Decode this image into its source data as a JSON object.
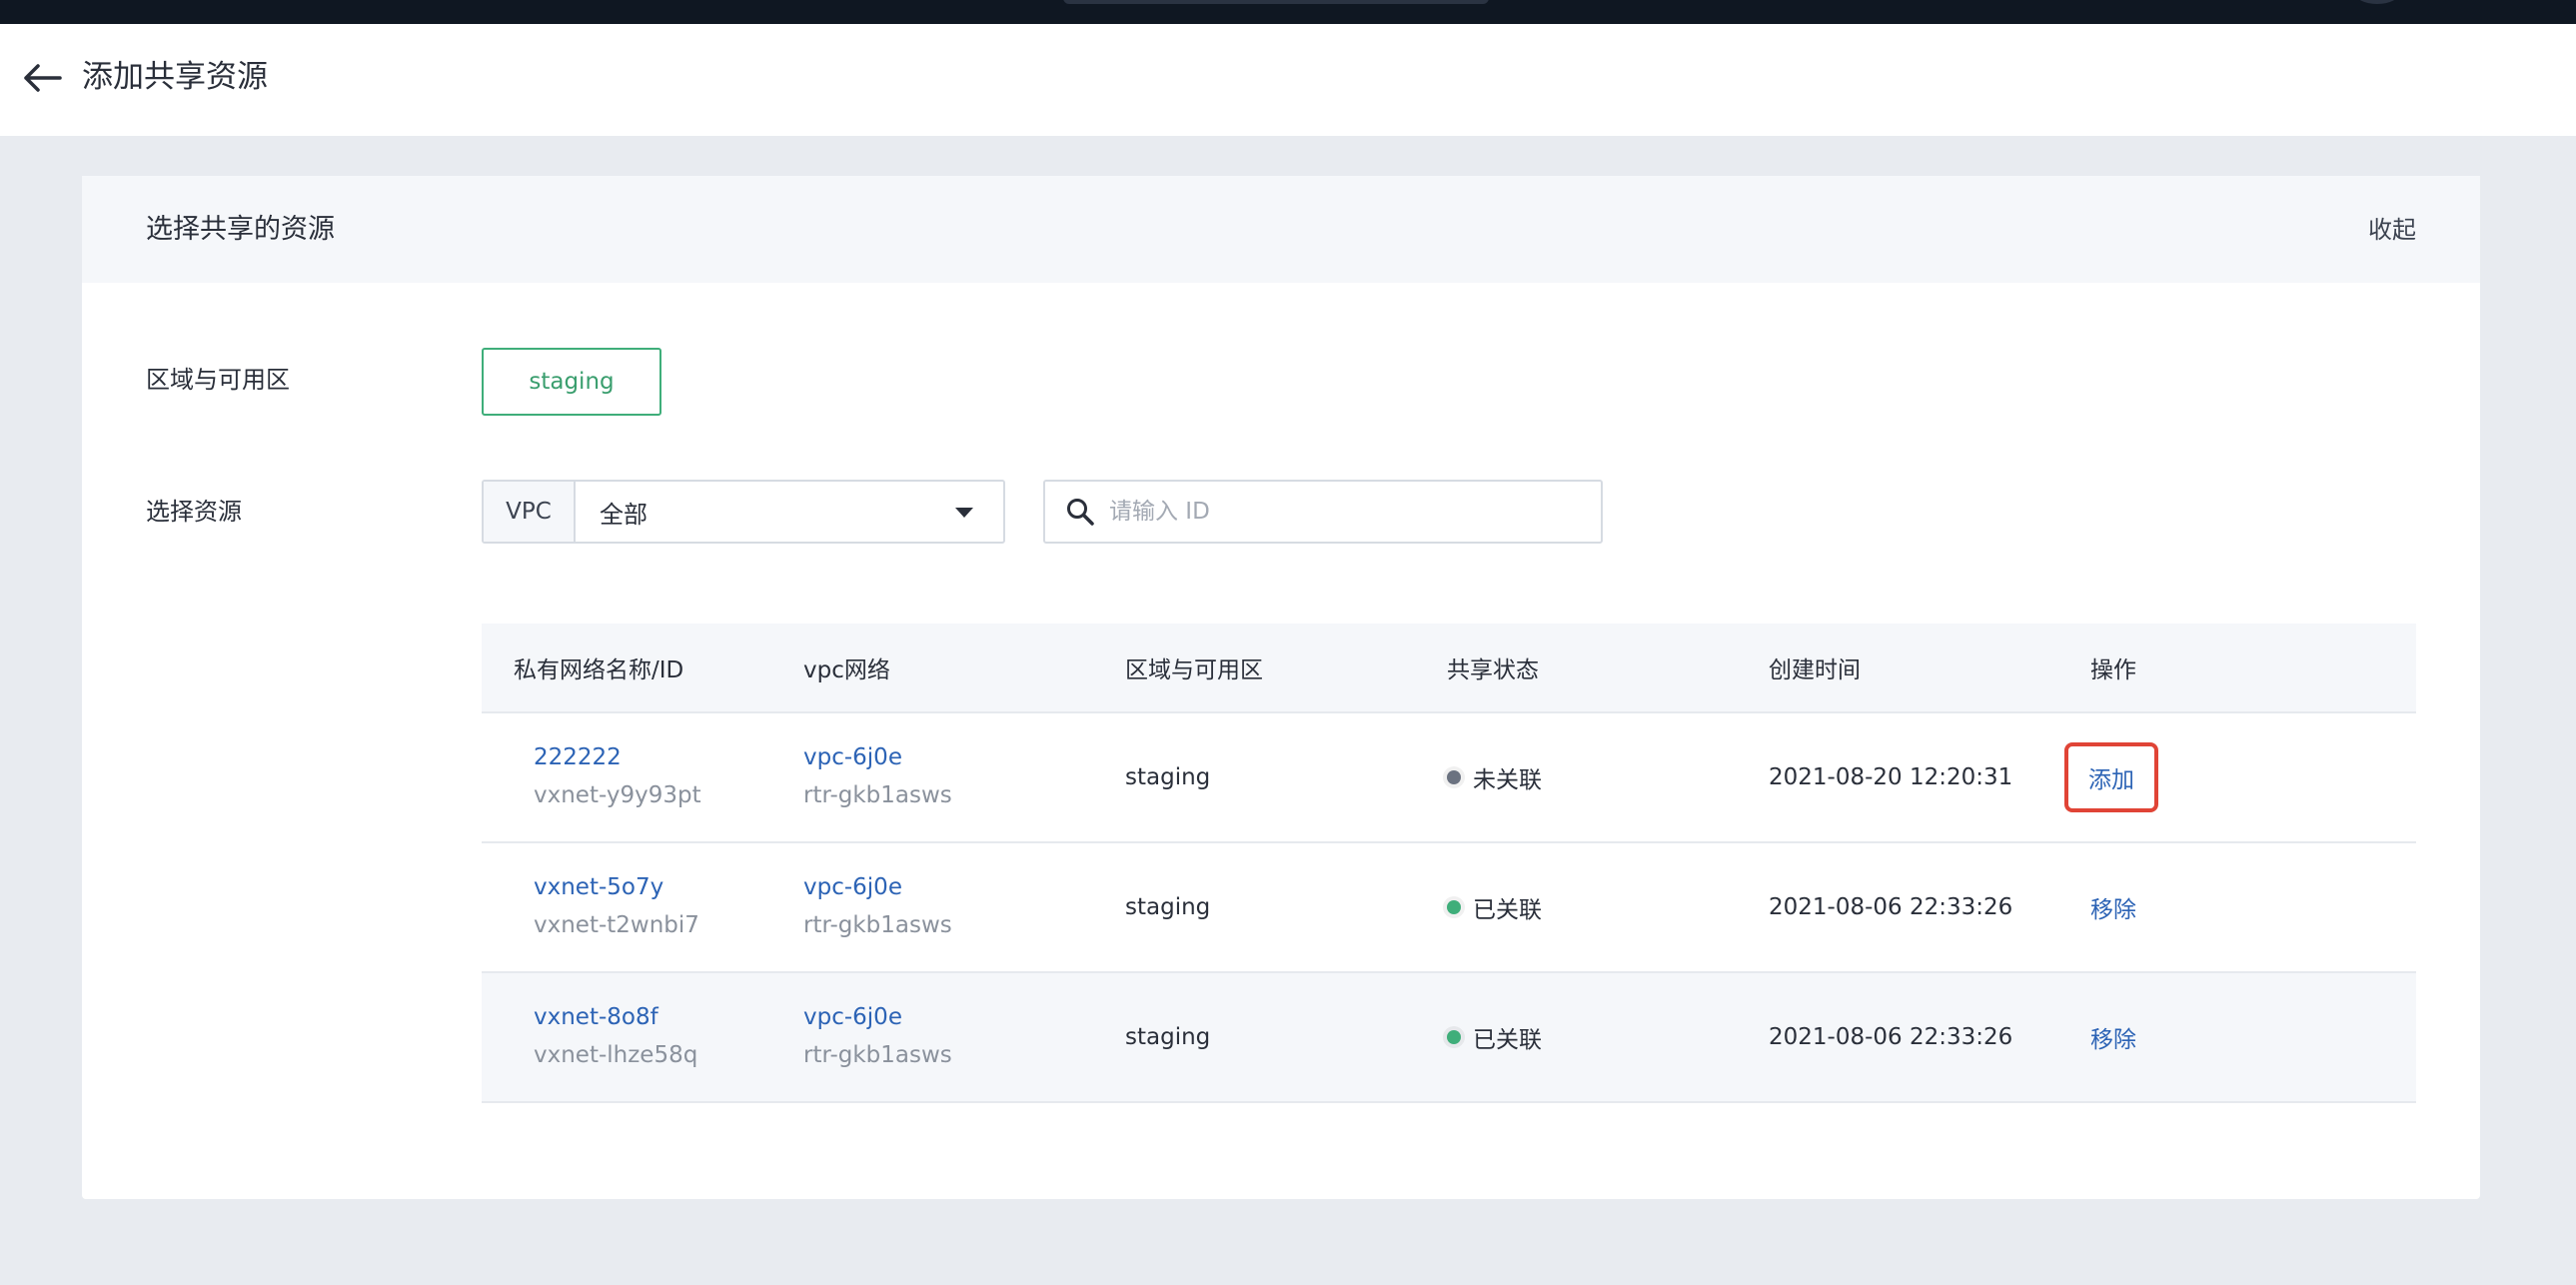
{
  "header": {
    "title": "添加共享资源"
  },
  "card": {
    "title": "选择共享的资源",
    "collapse_label": "收起",
    "zone_label": "区域与可用区",
    "zone_value": "staging",
    "resource_label": "选择资源",
    "select_prefix": "VPC",
    "select_value": "全部",
    "search_placeholder": "请输入 ID"
  },
  "table": {
    "columns": [
      "私有网络名称/ID",
      "vpc网络",
      "区域与可用区",
      "共享状态",
      "创建时间",
      "操作"
    ],
    "rows": [
      {
        "name": "222222",
        "id": "vxnet-y9y93pt",
        "vpc": "vpc-6j0e",
        "router": "rtr-gkb1asws",
        "zone": "staging",
        "status": "未关联",
        "status_color": "#6b7280",
        "created": "2021-08-20 12:20:31",
        "action": "添加"
      },
      {
        "name": "vxnet-5o7y",
        "id": "vxnet-t2wnbi7",
        "vpc": "vpc-6j0e",
        "router": "rtr-gkb1asws",
        "zone": "staging",
        "status": "已关联",
        "status_color": "#3fae7a",
        "created": "2021-08-06 22:33:26",
        "action": "移除"
      },
      {
        "name": "vxnet-8o8f",
        "id": "vxnet-lhze58q",
        "vpc": "vpc-6j0e",
        "router": "rtr-gkb1asws",
        "zone": "staging",
        "status": "已关联",
        "status_color": "#3fae7a",
        "created": "2021-08-06 22:33:26",
        "action": "移除"
      }
    ]
  },
  "colors": {
    "accent_green": "#3fae7a",
    "link_blue": "#2c63b5",
    "highlight_red": "#e04436"
  }
}
